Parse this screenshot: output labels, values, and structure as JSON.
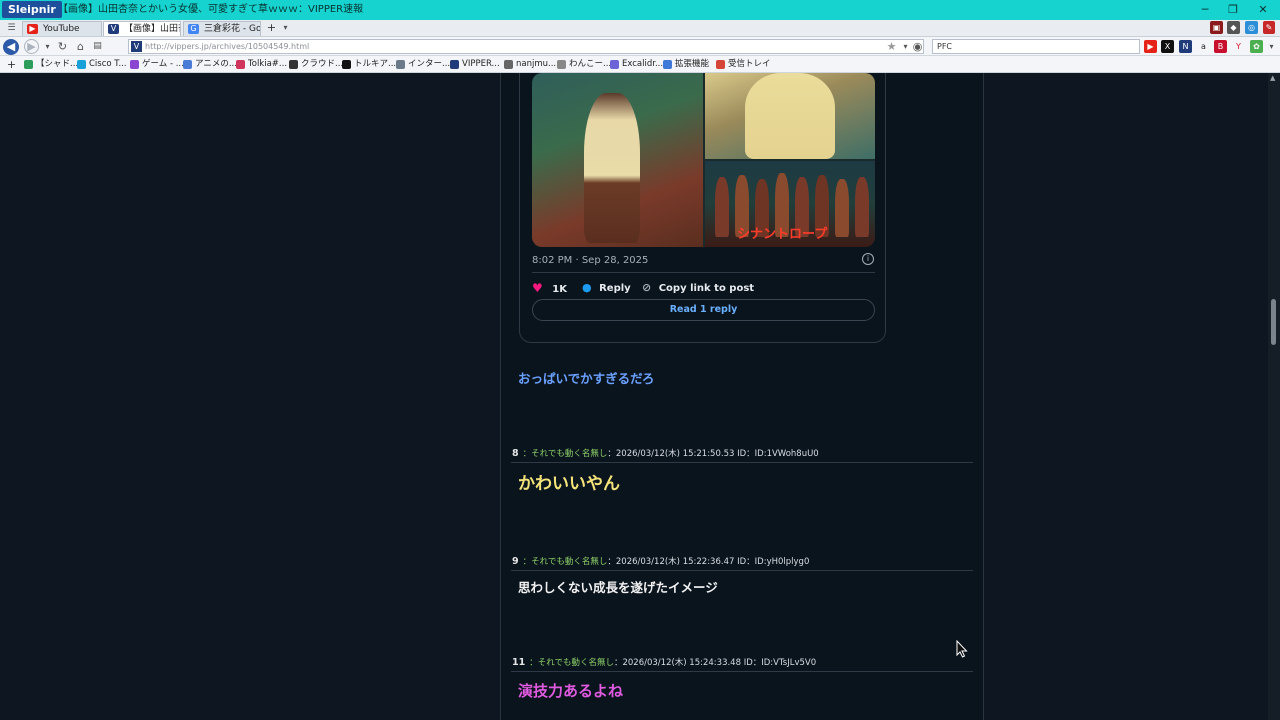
{
  "window": {
    "app_name": "Sleipnir",
    "title": "【画像】山田杏奈とかいう女優、可愛すぎて草ｗｗｗ：VIPPER速報",
    "controls": {
      "minimize": "─",
      "restore": "❐",
      "close": "✕"
    }
  },
  "tabs": [
    {
      "label": "YouTube",
      "icon": "youtube-icon",
      "active": false
    },
    {
      "label": "【画像】山田杏奈...",
      "icon": "vipper-icon",
      "active": true
    },
    {
      "label": "三倉彩花 - Goo...",
      "icon": "google-icon",
      "active": false
    }
  ],
  "tab_add": "+",
  "address": {
    "url": "http://vippers.jp/archives/10504549.html",
    "search_text": "PFC"
  },
  "bookmarks": [
    {
      "label": "【シャド...",
      "color": "#2e9c5a"
    },
    {
      "label": "Cisco T...",
      "color": "#1aa0d8"
    },
    {
      "label": "ゲーム - ...",
      "color": "#8a44d1"
    },
    {
      "label": "アニメの...",
      "color": "#4a7bd6"
    },
    {
      "label": "Tolkia#...",
      "color": "#d0345a"
    },
    {
      "label": "クラウド...",
      "color": "#333333"
    },
    {
      "label": "トルキア...",
      "color": "#111111"
    },
    {
      "label": "インター...",
      "color": "#6a7a8a"
    },
    {
      "label": "VIPPER...",
      "color": "#1f3b7a"
    },
    {
      "label": "nanjmu...",
      "color": "#666666"
    },
    {
      "label": "わんこー...",
      "color": "#888888"
    },
    {
      "label": "Excalidr...",
      "color": "#6b63d6"
    },
    {
      "label": "拡張機能",
      "color": "#3f78d8"
    },
    {
      "label": "受信トレイ",
      "color": "#d44638"
    }
  ],
  "tweet": {
    "time": "8:02 PM · Sep 28, 2025",
    "like_count": "1K",
    "reply_label": "Reply",
    "copy_label": "Copy link to post",
    "read_reply_label": "Read 1 reply",
    "image_caption": "シナントロープ"
  },
  "posts": [
    {
      "text": "おっぱいでかすぎるだろ",
      "color": "#6aa0ff"
    },
    {
      "number": "8",
      "name": "：それでも動く名無し",
      "meta": "：2026/03/12(木) 15:21:50.53 ID：ID:1VWoh8uU0",
      "text": "かわいいやん",
      "color": "#f3e37a"
    },
    {
      "number": "9",
      "name": "：それでも動く名無し",
      "meta": "：2026/03/12(木) 15:22:36.47 ID：ID:yH0lplyg0",
      "text": "思わしくない成長を遂げたイメージ",
      "color": "#f2f2f2"
    },
    {
      "number": "11",
      "name": "：それでも動く名無し",
      "meta": "：2026/03/12(木) 15:24:33.48 ID：ID:VTsJLv5V0",
      "text": "演技力あるよね",
      "color": "#e05ae0"
    }
  ]
}
